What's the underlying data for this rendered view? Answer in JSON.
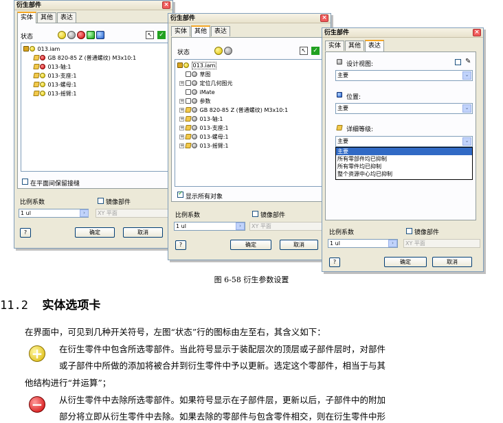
{
  "dialog_title": "衍生部件",
  "tabs": [
    "实体",
    "其他",
    "表达"
  ],
  "win1": {
    "status_label": "状态",
    "tree": [
      {
        "text": "013.iam"
      },
      {
        "text": "GB 820-85 Z (普通螺纹) M3x10:1"
      },
      {
        "text": "013-轴:1"
      },
      {
        "text": "013-支座:1"
      },
      {
        "text": "013-螺母:1"
      },
      {
        "text": "013-摇臂:1"
      }
    ],
    "checkbox_label": "在平面间保留接缝",
    "scale_label": "比例系数",
    "mirror_label": "镜像部件",
    "scale_value": "1 ul",
    "plane_value": "XY 平面",
    "ok_label": "确定",
    "cancel_label": "取消",
    "help_label": "?"
  },
  "win2": {
    "status_label": "状态",
    "tree": [
      {
        "text": "013.iam"
      },
      {
        "text": "草图"
      },
      {
        "text": "定位几何图元"
      },
      {
        "text": "iMate"
      },
      {
        "text": "参数"
      },
      {
        "text": "GB 820-85 Z (普通螺纹) M3x10:1"
      },
      {
        "text": "013-轴:1"
      },
      {
        "text": "013-支座:1"
      },
      {
        "text": "013-螺母:1"
      },
      {
        "text": "013-摇臂:1"
      }
    ],
    "checkbox_label": "显示所有对象",
    "scale_label": "比例系数",
    "mirror_label": "镜像部件",
    "scale_value": "1 ul",
    "plane_value": "XY 平面",
    "ok_label": "确定",
    "cancel_label": "取消",
    "help_label": "?"
  },
  "win3": {
    "design_view_label": "设计视图:",
    "design_view_value": "主要",
    "position_label": "位置:",
    "position_value": "主要",
    "lod_label": "详细等级:",
    "lod_value": "主要",
    "lod_options": [
      "主要",
      "所有零部件均已抑制",
      "所有零件均已抑制",
      "整个资源中心均已抑制"
    ],
    "scale_label": "比例系数",
    "mirror_label": "镜像部件",
    "scale_value": "1 ul",
    "plane_value": "XY 平面",
    "ok_label": "确定",
    "cancel_label": "取消",
    "help_label": "?"
  },
  "caption": "图 6-58  衍生参数设置",
  "heading_number": "11.2",
  "heading_text": "实体选项卡",
  "intro": "在界面中，可见到几种开关符号，左图“状态”行的图标由左至右，其含义如下：",
  "item1_line1": "在衍生零件中包含所选零部件。当此符号显示于装配层次的顶层或子部件层时，对部件",
  "item1_line2": "或子部件中所做的添加将被合并到衍生零件中予以更新。选定这个零部件，相当于与其",
  "item1_line3": "他结构进行“并运算”；",
  "item2_line1": "从衍生零件中去除所选零部件。如果符号显示在子部件层，更新以后，子部件中的附加",
  "item2_line2": "部分将立即从衍生零件中去除。如果去除的零部件与包含零件相交，则在衍生零件中形",
  "colors": {
    "include": "#e8c800",
    "exclude": "#d00000",
    "tab_highlight": "#f5a623",
    "title_close": "#f05a5a"
  }
}
